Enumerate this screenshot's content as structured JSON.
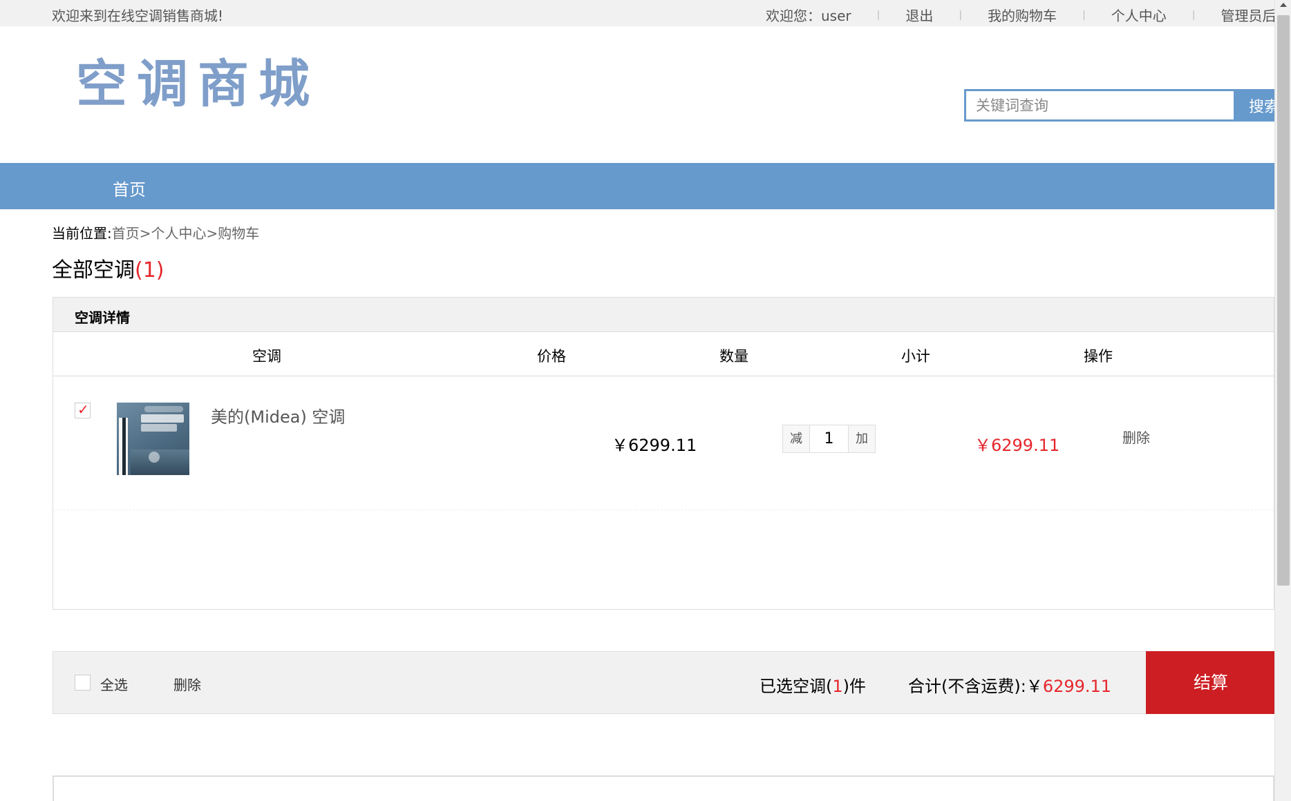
{
  "topbar": {
    "welcome": "欢迎来到在线空调销售商城!",
    "greeting": "欢迎您：user",
    "logout": "退出",
    "cart": "我的购物车",
    "profile": "个人中心",
    "admin": "管理员后"
  },
  "logo": {
    "text": "空调商城"
  },
  "search": {
    "placeholder": "关键词查询",
    "button": "搜索"
  },
  "nav": {
    "items": [
      {
        "label": "首页"
      }
    ]
  },
  "breadcrumb": {
    "label": "当前位置:",
    "path": "首页>个人中心>购物车"
  },
  "heading": {
    "title": "全部空调",
    "count": "(1)"
  },
  "cart": {
    "section_title": "空调详情",
    "columns": {
      "product": "空调",
      "price": "价格",
      "quantity": "数量",
      "subtotal": "小计",
      "action": "操作"
    },
    "items": [
      {
        "checked": true,
        "name": "美的(Midea) 空调",
        "price": "￥6299.11",
        "decrease": "减",
        "quantity": "1",
        "increase": "加",
        "subtotal": "￥6299.11",
        "delete": "删除"
      }
    ]
  },
  "footer": {
    "select_all": "全选",
    "delete": "删除",
    "selected_prefix": "已选空调(",
    "selected_count": "1",
    "selected_suffix": ")件",
    "total_label": "合计(不含运费):￥",
    "total_amount": "6299.11",
    "checkout": "结算"
  },
  "colors": {
    "accent": "#6699cc",
    "price_red": "#e5262b",
    "checkout_red": "#cc1e23"
  },
  "icons": {
    "checkbox_checked": "check-icon",
    "scroll_up": "chevron-up-icon"
  }
}
